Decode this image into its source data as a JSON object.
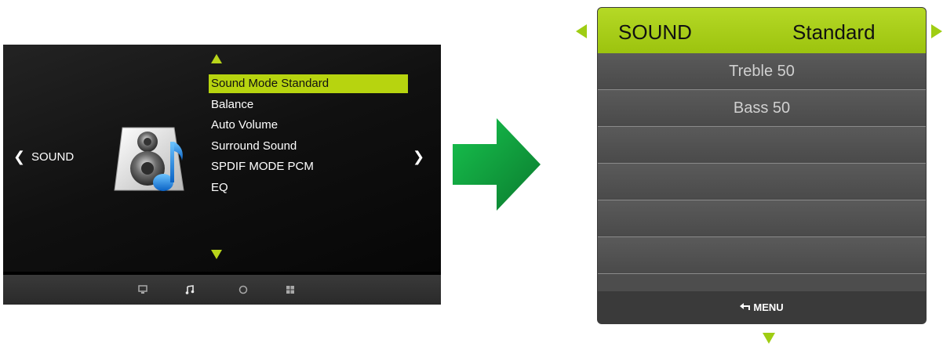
{
  "old_menu": {
    "section_label": "SOUND",
    "items": [
      {
        "label": "Sound Mode Standard"
      },
      {
        "label": "Balance"
      },
      {
        "label": "Auto Volume"
      },
      {
        "label": "Surround Sound"
      },
      {
        "label": "SPDIF MODE PCM"
      },
      {
        "label": "EQ"
      }
    ],
    "bottom_icons": [
      "monitor-icon",
      "music-note-icon",
      "clock-icon",
      "grid-icon"
    ],
    "accent_color": "#b7d40f"
  },
  "new_menu": {
    "header": {
      "title": "SOUND",
      "value": "Standard"
    },
    "rows": [
      {
        "label": "Treble 50"
      },
      {
        "label": "Bass 50"
      },
      {
        "label": ""
      },
      {
        "label": ""
      },
      {
        "label": ""
      },
      {
        "label": ""
      }
    ],
    "footer_label": "MENU",
    "accent_color": "#9fcd13"
  },
  "transition_arrow_color": "#1aa84a"
}
